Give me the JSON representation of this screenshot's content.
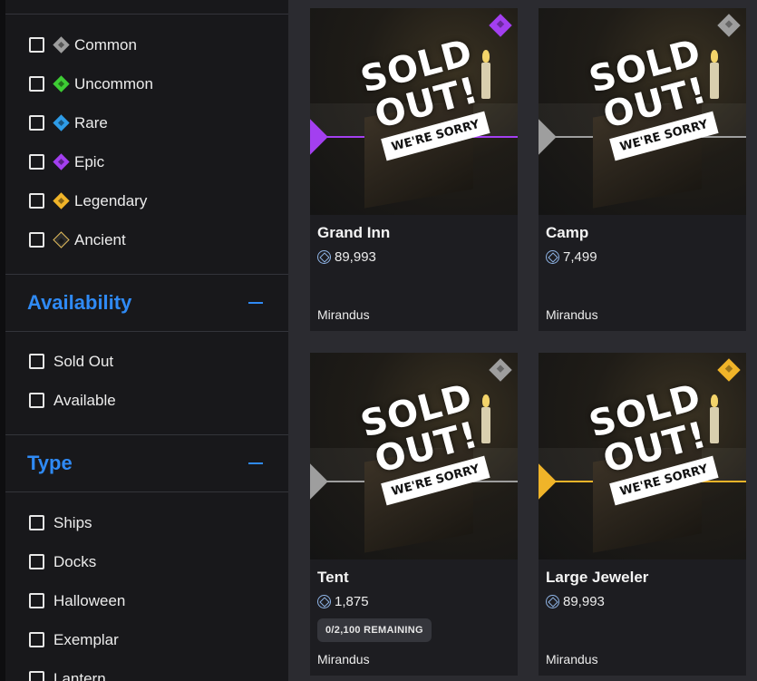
{
  "sidebar": {
    "rarity_items": [
      {
        "label": "Common",
        "color": "#9e9e9e"
      },
      {
        "label": "Uncommon",
        "color": "#3dcc34"
      },
      {
        "label": "Rare",
        "color": "#2e9ce8"
      },
      {
        "label": "Epic",
        "color": "#a33ff0"
      },
      {
        "label": "Legendary",
        "color": "#f0b429"
      },
      {
        "label": "Ancient",
        "color": "#2a2a2a"
      }
    ],
    "availability": {
      "title": "Availability",
      "items": [
        "Sold Out",
        "Available"
      ]
    },
    "type": {
      "title": "Type",
      "items": [
        "Ships",
        "Docks",
        "Halloween",
        "Exemplar",
        "Lantern"
      ]
    }
  },
  "overlay": {
    "sold_line1": "SOLD",
    "sold_line2": "OUT!",
    "sorry": "WE'RE SORRY"
  },
  "cards": [
    {
      "name": "Grand Inn",
      "price": "89,993",
      "publisher": "Mirandus",
      "rarity_color": "#a33ff0",
      "remaining": ""
    },
    {
      "name": "Camp",
      "price": "7,499",
      "publisher": "Mirandus",
      "rarity_color": "#9e9e9e",
      "remaining": ""
    },
    {
      "name": "Tent",
      "price": "1,875",
      "publisher": "Mirandus",
      "rarity_color": "#9e9e9e",
      "remaining": "0/2,100 REMAINING"
    },
    {
      "name": "Large Jeweler",
      "price": "89,993",
      "publisher": "Mirandus",
      "rarity_color": "#f0b429",
      "remaining": ""
    }
  ]
}
